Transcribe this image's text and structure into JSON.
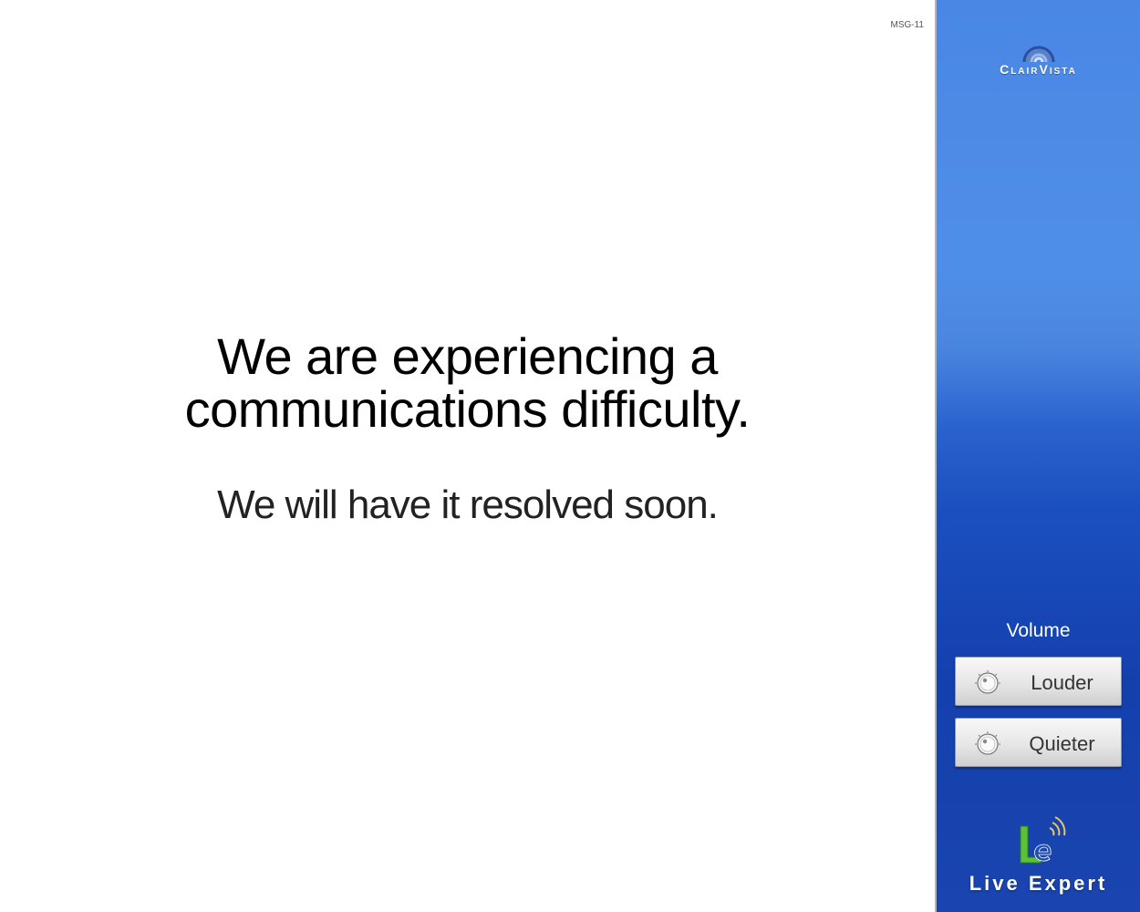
{
  "main": {
    "message_code": "MSG-11",
    "headline_line1": "We are experiencing a",
    "headline_line2": "communications difficulty.",
    "subline": "We will have it resolved soon."
  },
  "sidebar": {
    "brand_name": "ClairVista",
    "brand_icon": "clairvista-logo-icon",
    "volume_label": "Volume",
    "louder_label": "Louder",
    "quieter_label": "Quieter",
    "knob_icon": "volume-knob-icon",
    "footer_brand": "Live Expert",
    "footer_icon": "live-expert-logo-icon"
  },
  "colors": {
    "sidebar_top": "#4f8ee8",
    "sidebar_bottom": "#1440ad",
    "button_face": "#e6e6e6",
    "logo_green": "#5bc236"
  }
}
